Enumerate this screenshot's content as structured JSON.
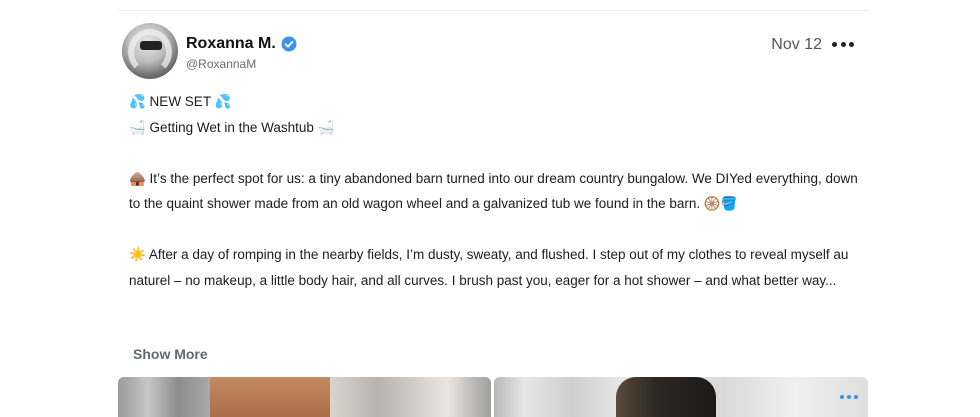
{
  "post": {
    "author_name": "Roxanna M.",
    "handle": "@RoxannaM",
    "date": "Nov 12",
    "verified": true,
    "lines": {
      "title": "💦 NEW SET 💦",
      "subtitle": "🛁 Getting Wet in the Washtub 🛁",
      "para1": "🛖 It’s the perfect spot for us: a tiny abandoned barn turned into our dream country bungalow. We DIYed everything, down to the quaint shower made from an old wagon wheel and a galvanized tub we found in the barn. 🛞🪣",
      "para2": "☀️ After a day of romping in the nearby fields, I’m dusty, sweaty, and flushed. I step out of my clothes to reveal myself au naturel – no makeup, a little body hair, and all curves. I brush past you, eager for a hot shower – and what better way..."
    },
    "show_more_label": "Show More",
    "icons": {
      "verified": "verified-badge-icon",
      "more": "more-options-icon",
      "media_more": "media-more-icon"
    },
    "colors": {
      "verified": "#3b94e8",
      "show_more": "#5f6a72"
    }
  }
}
